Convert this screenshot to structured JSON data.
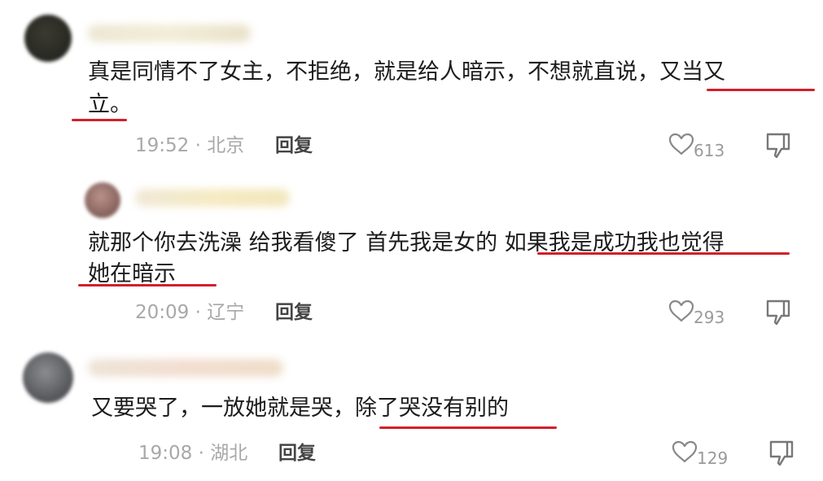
{
  "comments": [
    {
      "text_lines": [
        "真是同情不了女主，不拒绝，就是给人暗示，不想就直说，又当又",
        "立。"
      ],
      "time": "19:52",
      "location": "北京",
      "reply_label": "回复",
      "likes": "613"
    },
    {
      "text_lines": [
        "就那个你去洗澡 给我看傻了 首先我是女的 如果我是成功我也觉得",
        "她在暗示"
      ],
      "time": "20:09",
      "location": "辽宁",
      "reply_label": "回复",
      "likes": "293"
    },
    {
      "text_lines": [
        "又要哭了，一放她就是哭，除了哭没有别的"
      ],
      "time": "19:08",
      "location": "湖北",
      "reply_label": "回复",
      "likes": "129"
    }
  ],
  "meta_separator": "·",
  "icons": {
    "like": "heart-outline-icon",
    "dislike": "thumbs-down-outline-icon"
  },
  "colors": {
    "highlight_underline": "#d2202a",
    "meta_text": "#a8a8a8"
  }
}
